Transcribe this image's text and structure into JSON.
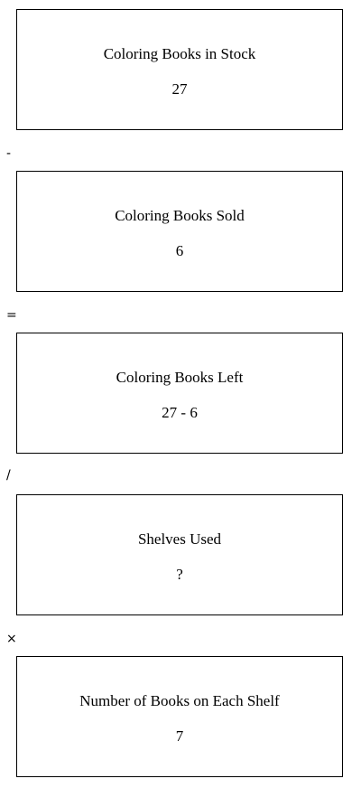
{
  "boxes": [
    {
      "label": "Coloring Books in Stock",
      "value": "27"
    },
    {
      "label": "Coloring Books Sold",
      "value": "6"
    },
    {
      "label": "Coloring Books Left",
      "value": "27 - 6"
    },
    {
      "label": "Shelves Used",
      "value": "?"
    },
    {
      "label": "Number of Books on Each Shelf",
      "value": "7"
    }
  ],
  "operators": [
    "-",
    "=",
    "/",
    "×"
  ]
}
